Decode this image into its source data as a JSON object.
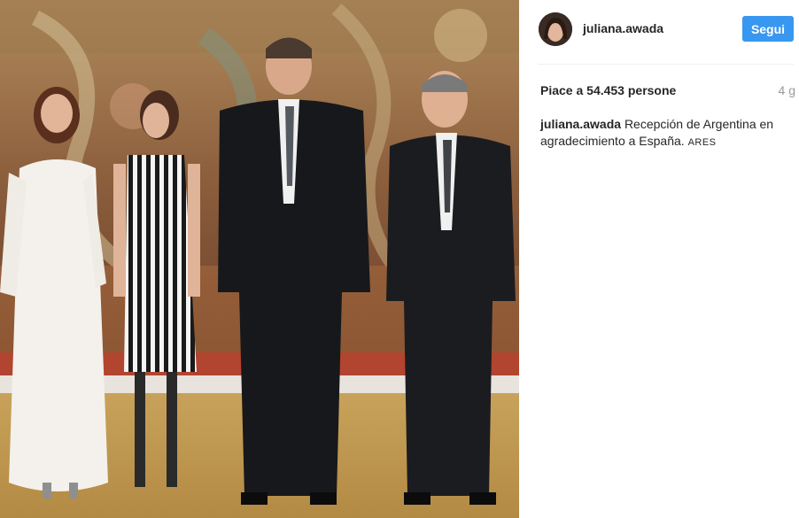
{
  "post": {
    "photo_alt": "",
    "username": "juliana.awada",
    "follow_label": "Segui",
    "likes_text": "Piace a 54.453 persone",
    "time_ago": "4 g",
    "caption": {
      "author": "juliana.awada",
      "text": "Recepción de Argentina en agradecimiento a España.",
      "tag": "ARES"
    }
  },
  "colors": {
    "follow_button": "#3897f0",
    "text_primary": "#262626",
    "text_muted": "#999999",
    "divider": "#efefef"
  }
}
